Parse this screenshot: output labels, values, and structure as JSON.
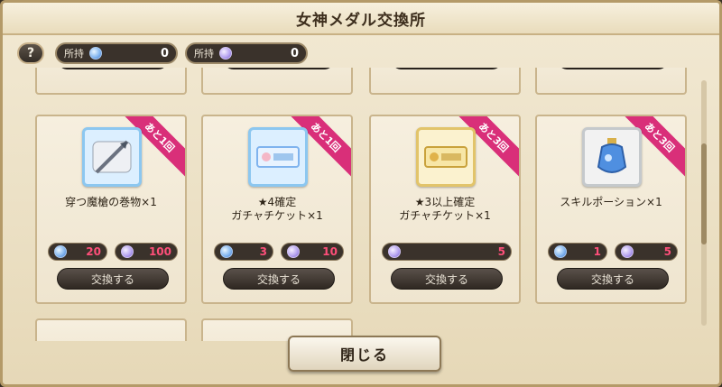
{
  "title": "女神メダル交換所",
  "help_label": "?",
  "holdings": [
    {
      "label": "所持",
      "value": "0",
      "medal": "blue-medal-icon"
    },
    {
      "label": "所持",
      "value": "0",
      "medal": "purple-medal-icon"
    }
  ],
  "exchange_label": "交換する",
  "items": [
    {
      "name_line1": "穿つ魔槍の巻物×1",
      "name_line2": "",
      "ribbon": "あと1回",
      "costs": [
        {
          "amount": "20",
          "medal": "blue"
        },
        {
          "amount": "100",
          "medal": "purple"
        }
      ],
      "icon": "spear-scroll-icon"
    },
    {
      "name_line1": "★4確定",
      "name_line2": "ガチャチケット×1",
      "ribbon": "あと1回",
      "costs": [
        {
          "amount": "3",
          "medal": "blue"
        },
        {
          "amount": "10",
          "medal": "purple"
        }
      ],
      "icon": "silver-ticket-icon"
    },
    {
      "name_line1": "★3以上確定",
      "name_line2": "ガチャチケット×1",
      "ribbon": "あと3回",
      "costs": [
        {
          "amount": "5",
          "medal": "purple"
        }
      ],
      "icon": "gold-ticket-icon"
    },
    {
      "name_line1": "スキルポーション×1",
      "name_line2": "",
      "ribbon": "あと3回",
      "costs": [
        {
          "amount": "1",
          "medal": "blue"
        },
        {
          "amount": "5",
          "medal": "purple"
        }
      ],
      "icon": "skill-potion-icon"
    }
  ],
  "close_label": "閉じる",
  "colors": {
    "ribbon": "#d92f79",
    "cost_text": "#ff4f7a",
    "frame": "#ece1c6"
  }
}
